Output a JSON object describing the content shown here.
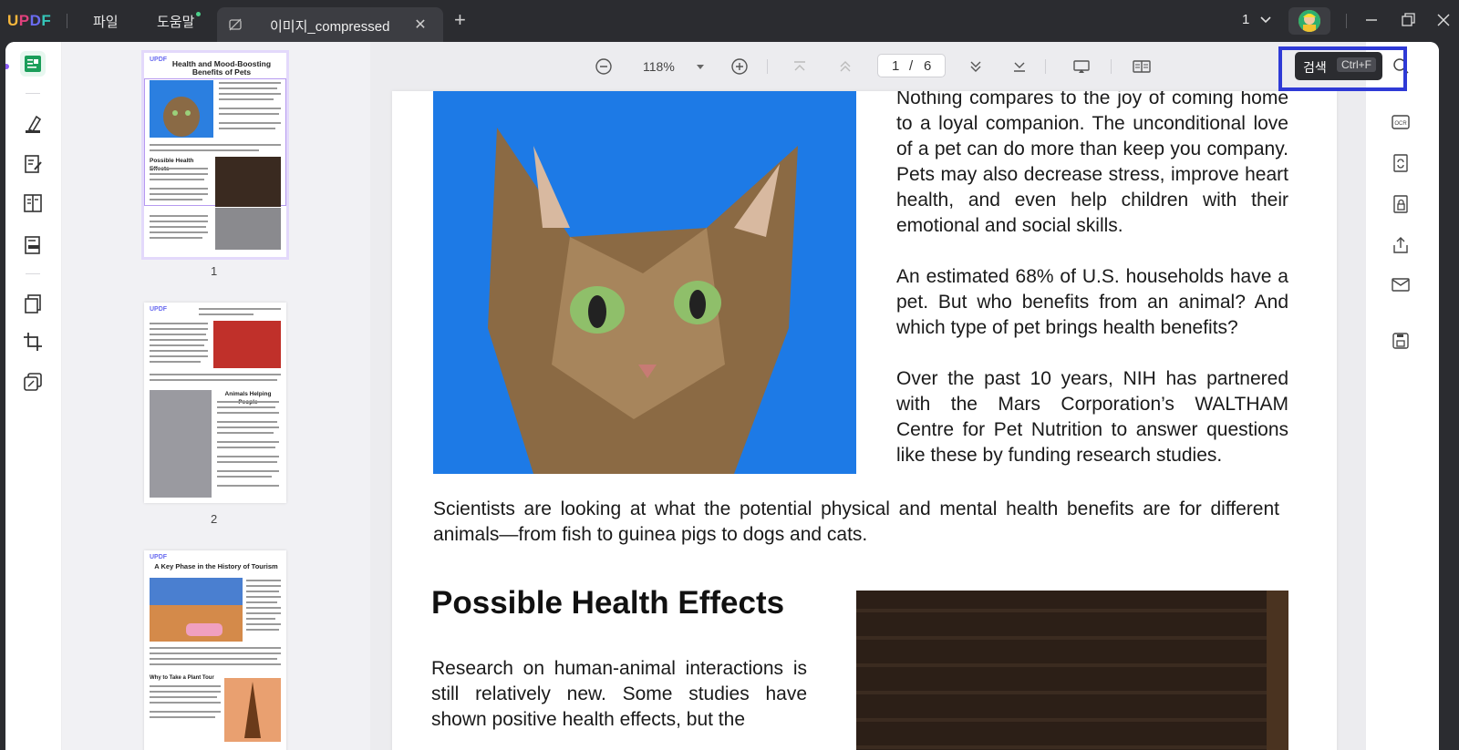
{
  "app": {
    "logo": "UPDF",
    "menu": [
      "파일",
      "도움말"
    ],
    "tab_title": "이미지_compressed",
    "page_count": "1"
  },
  "toolbar": {
    "zoom": "118%",
    "page_current": "1",
    "page_sep": "/",
    "page_total": "6"
  },
  "search_tooltip": {
    "label": "검색",
    "shortcut": "Ctrl+F"
  },
  "thumbnails": [
    {
      "number": "1",
      "title": "Health and Mood-Boosting Benefits of Pets",
      "section": "Possible Health Effects"
    },
    {
      "number": "2",
      "title": "Animals Helping People"
    },
    {
      "number": "",
      "title": "A Key Phase in the History of Tourism",
      "section": "Why to Take a Plant Tour"
    }
  ],
  "document": {
    "para1": "Nothing compares to the joy of coming home to a loyal companion. The unconditional love of a pet can do more than keep you company. Pets may also decrease stress, improve heart health, and even help children with their emotional and social skills.",
    "para2": "An estimated 68% of U.S. households have a pet. But who benefits from an animal? And which type of pet brings health benefits?",
    "para3": "Over the past 10 years, NIH has partnered with the Mars Corporation’s WALTHAM Centre for Pet Nutrition to answer questions like these by funding research studies.",
    "para4": "Scientists are looking at what the potential physical and mental health benefits are for different animals—from fish to guinea pigs to dogs and cats.",
    "heading": "Possible Health Effects",
    "para5": "Research on human-animal interactions is still relatively new. Some studies have shown positive health effects, but the"
  },
  "colors": {
    "titlebar": "#2b2c30",
    "accent_highlight": "#2f3ad6",
    "thumb_active": "#e3d9fb"
  }
}
